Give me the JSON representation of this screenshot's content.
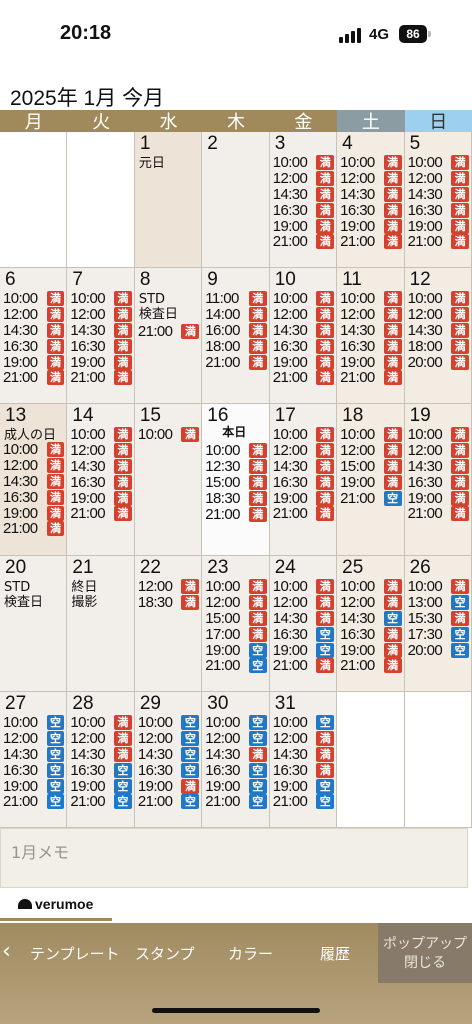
{
  "status": {
    "time": "20:18",
    "network": "4G",
    "battery": "86"
  },
  "month_title": "2025年 1月 今月",
  "weekdays": [
    "月",
    "火",
    "水",
    "木",
    "金",
    "土",
    "日"
  ],
  "calendar": {
    "weeks": [
      [
        null,
        null,
        {
          "day": "1",
          "label": "元日",
          "type": "holiday",
          "slots": []
        },
        {
          "day": "2",
          "slots": []
        },
        {
          "day": "3",
          "slots": [
            [
              "10:00",
              "満"
            ],
            [
              "12:00",
              "満"
            ],
            [
              "14:30",
              "満"
            ],
            [
              "16:30",
              "満"
            ],
            [
              "19:00",
              "満"
            ],
            [
              "21:00",
              "満"
            ]
          ]
        },
        {
          "day": "4",
          "type": "weekend",
          "slots": [
            [
              "10:00",
              "満"
            ],
            [
              "12:00",
              "満"
            ],
            [
              "14:30",
              "満"
            ],
            [
              "16:30",
              "満"
            ],
            [
              "19:00",
              "満"
            ],
            [
              "21:00",
              "満"
            ]
          ]
        },
        {
          "day": "5",
          "type": "weekend",
          "slots": [
            [
              "10:00",
              "満"
            ],
            [
              "12:00",
              "満"
            ],
            [
              "14:30",
              "満"
            ],
            [
              "16:30",
              "満"
            ],
            [
              "19:00",
              "満"
            ],
            [
              "21:00",
              "満"
            ]
          ]
        }
      ],
      [
        {
          "day": "6",
          "slots": [
            [
              "10:00",
              "満"
            ],
            [
              "12:00",
              "満"
            ],
            [
              "14:30",
              "満"
            ],
            [
              "16:30",
              "満"
            ],
            [
              "19:00",
              "満"
            ],
            [
              "21:00",
              "満"
            ]
          ]
        },
        {
          "day": "7",
          "slots": [
            [
              "10:00",
              "満"
            ],
            [
              "12:00",
              "満"
            ],
            [
              "14:30",
              "満"
            ],
            [
              "16:30",
              "満"
            ],
            [
              "19:00",
              "満"
            ],
            [
              "21:00",
              "満"
            ]
          ]
        },
        {
          "day": "8",
          "label": "STD\n検査日",
          "slots": [
            [
              "21:00",
              "満"
            ]
          ]
        },
        {
          "day": "9",
          "slots": [
            [
              "11:00",
              "満"
            ],
            [
              "14:00",
              "満"
            ],
            [
              "16:00",
              "満"
            ],
            [
              "18:00",
              "満"
            ],
            [
              "21:00",
              "満"
            ]
          ]
        },
        {
          "day": "10",
          "slots": [
            [
              "10:00",
              "満"
            ],
            [
              "12:00",
              "満"
            ],
            [
              "14:30",
              "満"
            ],
            [
              "16:30",
              "満"
            ],
            [
              "19:00",
              "満"
            ],
            [
              "21:00",
              "満"
            ]
          ]
        },
        {
          "day": "11",
          "type": "weekend",
          "slots": [
            [
              "10:00",
              "満"
            ],
            [
              "12:00",
              "満"
            ],
            [
              "14:30",
              "満"
            ],
            [
              "16:30",
              "満"
            ],
            [
              "19:00",
              "満"
            ],
            [
              "21:00",
              "満"
            ]
          ]
        },
        {
          "day": "12",
          "type": "weekend",
          "slots": [
            [
              "10:00",
              "満"
            ],
            [
              "12:00",
              "満"
            ],
            [
              "14:30",
              "満"
            ],
            [
              "18:00",
              "満"
            ],
            [
              "20:00",
              "満"
            ]
          ]
        }
      ],
      [
        {
          "day": "13",
          "label": "成人の日",
          "type": "holiday",
          "slots": [
            [
              "10:00",
              "満"
            ],
            [
              "12:00",
              "満"
            ],
            [
              "14:30",
              "満"
            ],
            [
              "16:30",
              "満"
            ],
            [
              "19:00",
              "満"
            ],
            [
              "21:00",
              "満"
            ]
          ]
        },
        {
          "day": "14",
          "slots": [
            [
              "10:00",
              "満"
            ],
            [
              "12:00",
              "満"
            ],
            [
              "14:30",
              "満"
            ],
            [
              "16:30",
              "満"
            ],
            [
              "19:00",
              "満"
            ],
            [
              "21:00",
              "満"
            ]
          ]
        },
        {
          "day": "15",
          "slots": [
            [
              "10:00",
              "満"
            ]
          ]
        },
        {
          "day": "16",
          "label": "本日",
          "type": "today",
          "slots": [
            [
              "10:00",
              "満"
            ],
            [
              "12:30",
              "満"
            ],
            [
              "15:00",
              "満"
            ],
            [
              "18:30",
              "満"
            ],
            [
              "21:00",
              "満"
            ]
          ]
        },
        {
          "day": "17",
          "slots": [
            [
              "10:00",
              "満"
            ],
            [
              "12:00",
              "満"
            ],
            [
              "14:30",
              "満"
            ],
            [
              "16:30",
              "満"
            ],
            [
              "19:00",
              "満"
            ],
            [
              "21:00",
              "満"
            ]
          ]
        },
        {
          "day": "18",
          "type": "weekend",
          "slots": [
            [
              "10:00",
              "満"
            ],
            [
              "12:00",
              "満"
            ],
            [
              "15:00",
              "満"
            ],
            [
              "19:00",
              "満"
            ],
            [
              "21:00",
              "空"
            ]
          ]
        },
        {
          "day": "19",
          "type": "weekend",
          "slots": [
            [
              "10:00",
              "満"
            ],
            [
              "12:00",
              "満"
            ],
            [
              "14:30",
              "満"
            ],
            [
              "16:30",
              "満"
            ],
            [
              "19:00",
              "満"
            ],
            [
              "21:00",
              "満"
            ]
          ]
        }
      ],
      [
        {
          "day": "20",
          "label": "STD\n検査日",
          "slots": []
        },
        {
          "day": "21",
          "label": "終日\n撮影",
          "slots": []
        },
        {
          "day": "22",
          "slots": [
            [
              "12:00",
              "満"
            ],
            [
              "18:30",
              "満"
            ]
          ]
        },
        {
          "day": "23",
          "slots": [
            [
              "10:00",
              "満"
            ],
            [
              "12:00",
              "満"
            ],
            [
              "15:00",
              "満"
            ],
            [
              "17:00",
              "満"
            ],
            [
              "19:00",
              "空"
            ],
            [
              "21:00",
              "空"
            ]
          ]
        },
        {
          "day": "24",
          "slots": [
            [
              "10:00",
              "満"
            ],
            [
              "12:00",
              "満"
            ],
            [
              "14:30",
              "満"
            ],
            [
              "16:30",
              "空"
            ],
            [
              "19:00",
              "空"
            ],
            [
              "21:00",
              "満"
            ]
          ]
        },
        {
          "day": "25",
          "type": "weekend",
          "slots": [
            [
              "10:00",
              "満"
            ],
            [
              "12:00",
              "満"
            ],
            [
              "14:30",
              "空"
            ],
            [
              "16:30",
              "満"
            ],
            [
              "19:00",
              "満"
            ],
            [
              "21:00",
              "満"
            ]
          ]
        },
        {
          "day": "26",
          "type": "weekend",
          "slots": [
            [
              "10:00",
              "満"
            ],
            [
              "13:00",
              "空"
            ],
            [
              "15:30",
              "満"
            ],
            [
              "17:30",
              "空"
            ],
            [
              "20:00",
              "空"
            ]
          ]
        }
      ],
      [
        {
          "day": "27",
          "slots": [
            [
              "10:00",
              "空"
            ],
            [
              "12:00",
              "空"
            ],
            [
              "14:30",
              "空"
            ],
            [
              "16:30",
              "空"
            ],
            [
              "19:00",
              "空"
            ],
            [
              "21:00",
              "空"
            ]
          ]
        },
        {
          "day": "28",
          "slots": [
            [
              "10:00",
              "満"
            ],
            [
              "12:00",
              "満"
            ],
            [
              "14:30",
              "満"
            ],
            [
              "16:30",
              "空"
            ],
            [
              "19:00",
              "空"
            ],
            [
              "21:00",
              "空"
            ]
          ]
        },
        {
          "day": "29",
          "slots": [
            [
              "10:00",
              "空"
            ],
            [
              "12:00",
              "空"
            ],
            [
              "14:30",
              "空"
            ],
            [
              "16:30",
              "空"
            ],
            [
              "19:00",
              "満"
            ],
            [
              "21:00",
              "空"
            ]
          ]
        },
        {
          "day": "30",
          "slots": [
            [
              "10:00",
              "空"
            ],
            [
              "12:00",
              "空"
            ],
            [
              "14:30",
              "満"
            ],
            [
              "16:30",
              "空"
            ],
            [
              "19:00",
              "空"
            ],
            [
              "21:00",
              "空"
            ]
          ]
        },
        {
          "day": "31",
          "slots": [
            [
              "10:00",
              "空"
            ],
            [
              "12:00",
              "満"
            ],
            [
              "14:30",
              "満"
            ],
            [
              "16:30",
              "満"
            ],
            [
              "19:00",
              "空"
            ],
            [
              "21:00",
              "空"
            ]
          ]
        },
        null,
        null
      ]
    ]
  },
  "memo": {
    "placeholder": "1月メモ"
  },
  "logo": {
    "text": "verumoe"
  },
  "toolbar": {
    "back": "‹",
    "template": "テンプレート",
    "stamp": "スタンプ",
    "color": "カラー",
    "history": "履歴",
    "close_line1": "ポップアップ",
    "close_line2": "閉じる"
  },
  "colors": {
    "full": "#d6402f",
    "open": "#1f78c8",
    "header": "#a08a5c",
    "saturday": "#8b9da3",
    "sunday": "#9dd0ef"
  }
}
